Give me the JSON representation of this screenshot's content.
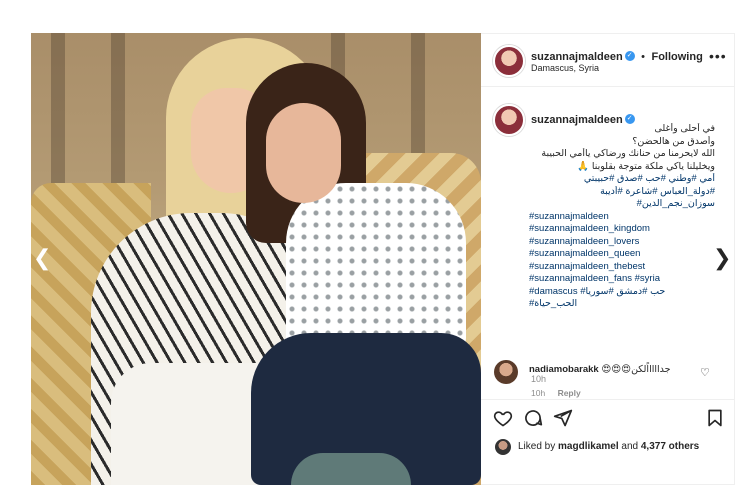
{
  "post": {
    "username": "suzannajmaldeen",
    "location": "Damascus, Syria",
    "follow_status": "Following",
    "separator": "•",
    "more": "•••"
  },
  "caption": {
    "username": "suzannajmaldeen",
    "time": "10h",
    "lines": [
      {
        "text": "في أحلى وأغلى",
        "style": "rtl"
      },
      {
        "text": "وأصدق من هالحضن؟",
        "style": "rtl"
      },
      {
        "text": "الله لايحرمنا من حنانك ورضاكي ياأمي الحبيبة",
        "style": "rtl"
      },
      {
        "text": "ويخليلنا ياكي ملكة متوجة بقلوبنا 🙏",
        "style": "rtl"
      },
      {
        "text": "أمي #وطني #حب #صدق #حبيبتي",
        "style": "rtl-tag"
      },
      {
        "text": "#دولة_العباس #شاعرة #أديبة",
        "style": "rtl-tag"
      },
      {
        "text": "سوزان_نجم_الدين#",
        "style": "rtl-tag"
      },
      {
        "text": "#suzannajmaldeen",
        "style": "ltr-tag"
      },
      {
        "text": "#suzannajmaldeen_kingdom",
        "style": "ltr-tag"
      },
      {
        "text": "#suzannajmaldeen_lovers",
        "style": "ltr-tag"
      },
      {
        "text": "#suzannajmaldeen_queen",
        "style": "ltr-tag"
      },
      {
        "text": "#suzannajmaldeen_thebest",
        "style": "ltr-tag"
      },
      {
        "text": "#suzannajmaldeen_fans #syria",
        "style": "ltr-tag"
      },
      {
        "text": "#damascus #حب #دمشق #سوريا",
        "style": "ltr-tag"
      },
      {
        "text": "#الحب_حياة",
        "style": "ltr-tag"
      }
    ]
  },
  "comment": {
    "username": "nadiamobarakk",
    "text": "😍😍😍جداااااًلكن",
    "time": "10h",
    "reply": "Reply"
  },
  "likes": {
    "prefix": "Liked by",
    "user": "magdlikamel",
    "middle": "and",
    "others": "4,377 others"
  },
  "icons": [
    "heart-icon",
    "comment-icon",
    "share-icon",
    "bookmark-icon",
    "verified-badge-icon",
    "chevron-left-icon",
    "chevron-right-icon",
    "more-options-icon"
  ],
  "colors": {
    "verified": "#3897f0",
    "hashtag": "#003569",
    "text": "#262626",
    "muted": "#8e8e8e"
  }
}
